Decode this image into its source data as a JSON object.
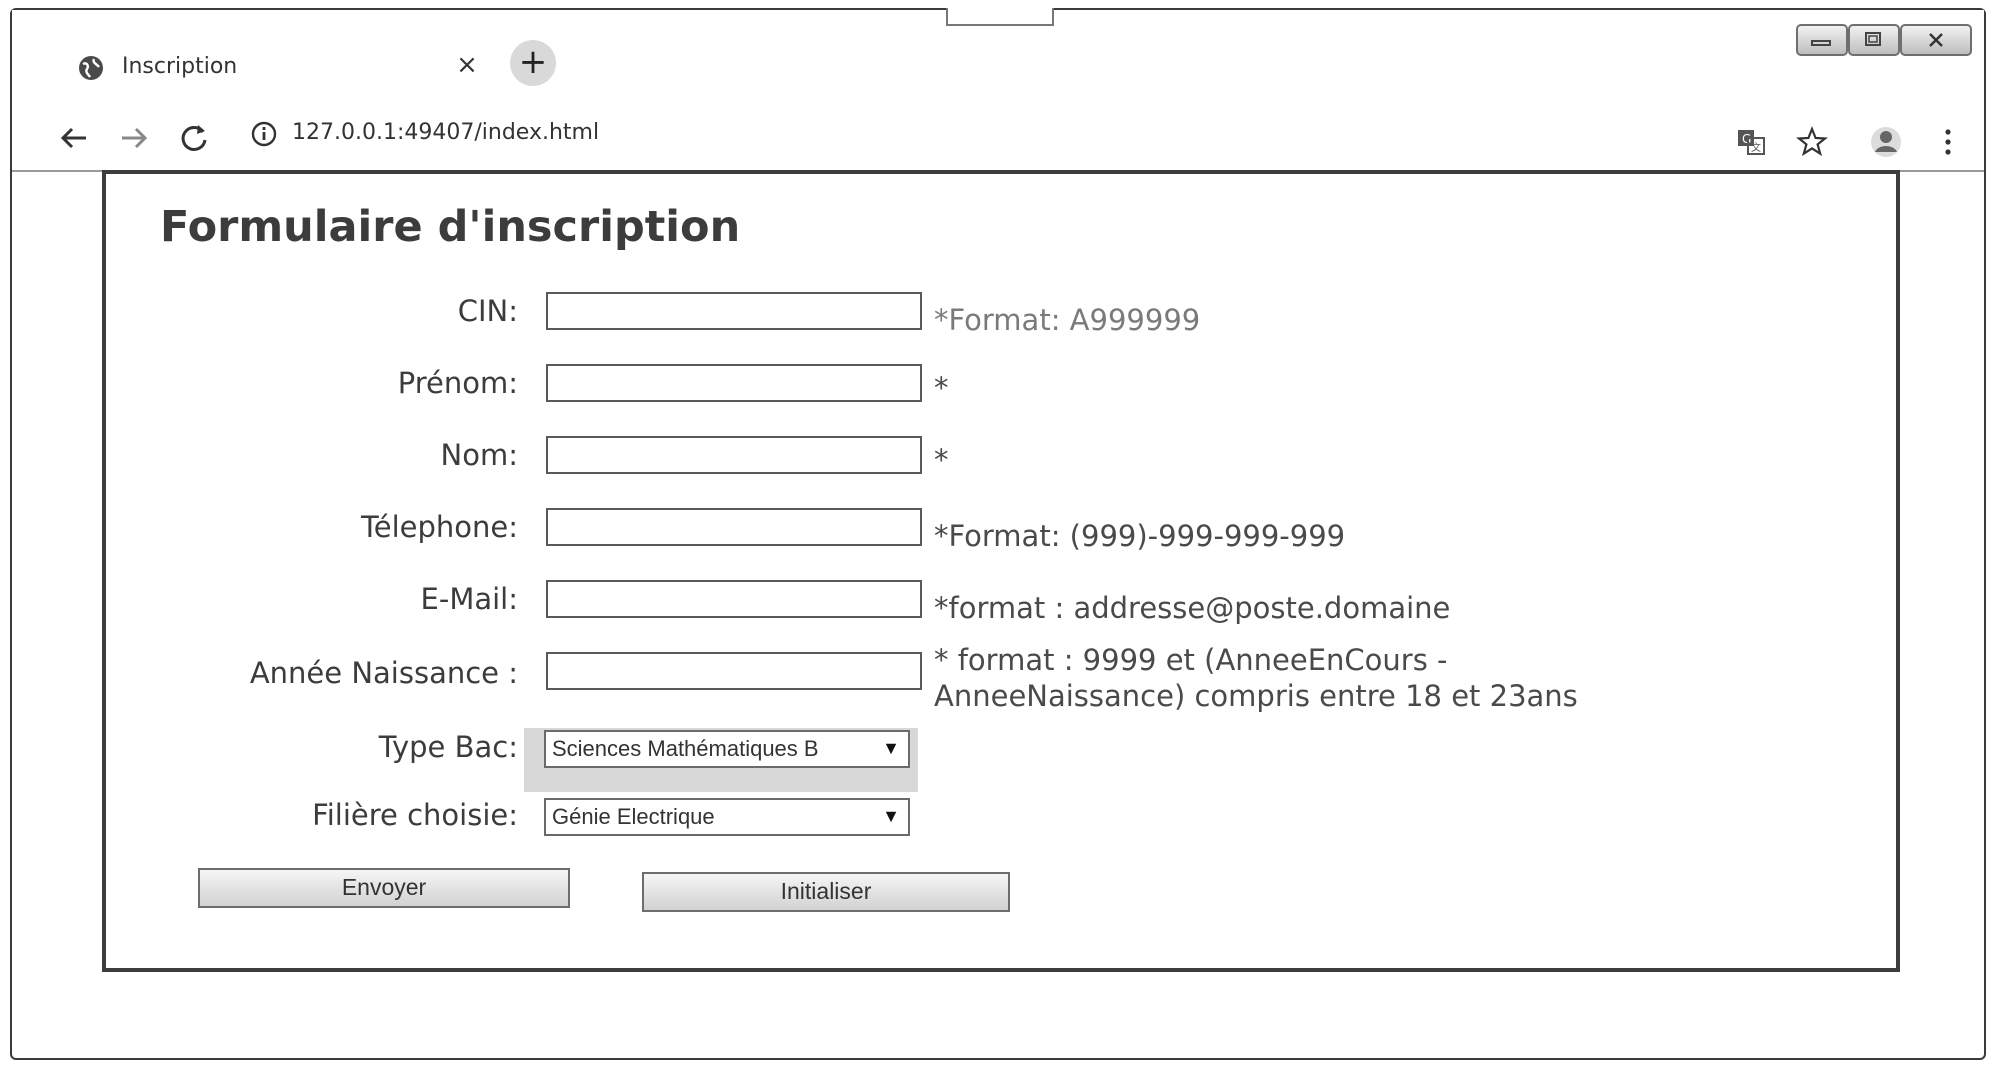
{
  "browser": {
    "tab": {
      "title": "Inscription",
      "favicon": "globe-icon",
      "close_glyph": "×"
    },
    "new_tab_glyph": "+",
    "address": {
      "url": "127.0.0.1:49407/index.html",
      "icon": "info-icon"
    },
    "nav_icons": [
      "back-arrow-icon",
      "forward-arrow-icon",
      "reload-icon"
    ],
    "right_icons": [
      "translate-icon",
      "star-icon",
      "profile-icon",
      "menu-dots-icon"
    ],
    "window_controls": [
      "minimize-icon",
      "restore-icon",
      "close-icon"
    ]
  },
  "form": {
    "title": "Formulaire d'inscription",
    "fields": [
      {
        "label": "CIN:",
        "value": "",
        "hint": "*Format: A999999"
      },
      {
        "label": "Prénom:",
        "value": "",
        "hint": "*"
      },
      {
        "label": "Nom:",
        "value": "",
        "hint": "*"
      },
      {
        "label": "Télephone:",
        "value": "",
        "hint": "*Format: (999)-999-999-999"
      },
      {
        "label": "E-Mail:",
        "value": "",
        "hint": "*format : addresse@poste.domaine"
      },
      {
        "label": "Année Naissance :",
        "value": "",
        "hint_line1": "* format : 9999 et (AnneeEnCours -",
        "hint_line2": "AnneeNaissance) compris entre 18 et 23ans"
      }
    ],
    "type_bac": {
      "label": "Type Bac:",
      "selected": "Sciences Mathématiques B"
    },
    "filiere": {
      "label": "Filière choisie:",
      "selected": "Génie Electrique"
    },
    "buttons": {
      "submit": "Envoyer",
      "reset": "Initialiser"
    }
  },
  "colors": {
    "border": "#3d3d3d",
    "text": "#3c3c3c",
    "hint_light": "#7a7a7a"
  }
}
